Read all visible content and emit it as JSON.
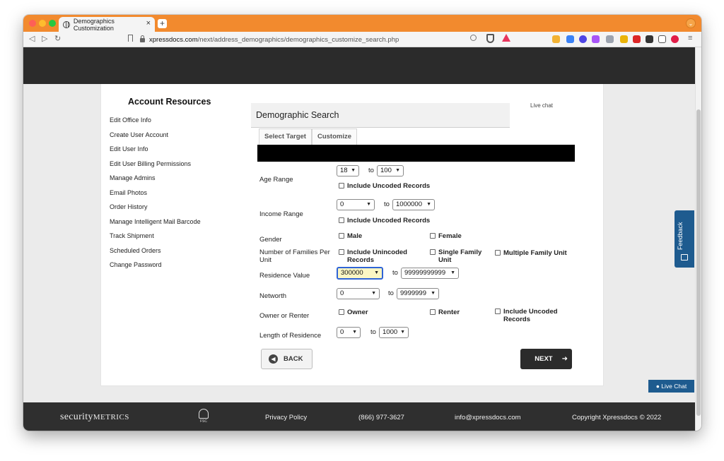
{
  "browser": {
    "tab_title": "Demographics Customization",
    "tab_close": "×",
    "new_tab": "+",
    "url_domain": "xpressdocs.com",
    "url_path": "/next/address_demographics/demographics_customize_search.php"
  },
  "sidebar": {
    "title": "Account Resources",
    "items": [
      "Edit Office Info",
      "Create User Account",
      "Edit User Info",
      "Edit User Billing Permissions",
      "Manage Admins",
      "Email Photos",
      "Order History",
      "Manage Intelligent Mail Barcode",
      "Track Shipment",
      "Scheduled Orders",
      "Change Password"
    ]
  },
  "live_chat_text": "Live chat",
  "panel": {
    "title": "Demographic Search",
    "tabs": [
      "Select Target",
      "Customize"
    ]
  },
  "form": {
    "to": "to",
    "age_range": {
      "label": "Age Range",
      "from": "18",
      "to": "100",
      "uncoded": "Include Uncoded Records"
    },
    "income_range": {
      "label": "Income Range",
      "from": "0",
      "to": "1000000",
      "uncoded": "Include Uncoded Records"
    },
    "gender": {
      "label": "Gender",
      "male": "Male",
      "female": "Female"
    },
    "families": {
      "label": "Number of Families Per Unit",
      "unincoded": "Include Unincoded Records",
      "single": "Single Family Unit",
      "multiple": "Multiple Family Unit"
    },
    "residence_value": {
      "label": "Residence Value",
      "from": "300000",
      "to": "99999999999"
    },
    "networth": {
      "label": "Networth",
      "from": "0",
      "to": "9999999"
    },
    "owner_renter": {
      "label": "Owner or Renter",
      "owner": "Owner",
      "renter": "Renter",
      "uncoded": "Include Uncoded Records"
    },
    "length_residence": {
      "label": "Length of Residence",
      "from": "0",
      "to": "1000"
    }
  },
  "buttons": {
    "back": "BACK",
    "next": "NEXT",
    "live_chat": "Live Chat",
    "feedback": "Feedback"
  },
  "footer": {
    "logo_main": "security",
    "logo_sub": "METRICS",
    "fsc": "FSC",
    "privacy": "Privacy Policy",
    "phone": "(866) 977-3627",
    "email": "info@xpressdocs.com",
    "copyright": "Copyright Xpressdocs © 2022"
  },
  "colors": {
    "tabbar": "#f28a2e",
    "header_band": "#2b2b2b",
    "accent_blue": "#1e5b8f",
    "highlight_field": "#fbf6c4"
  }
}
